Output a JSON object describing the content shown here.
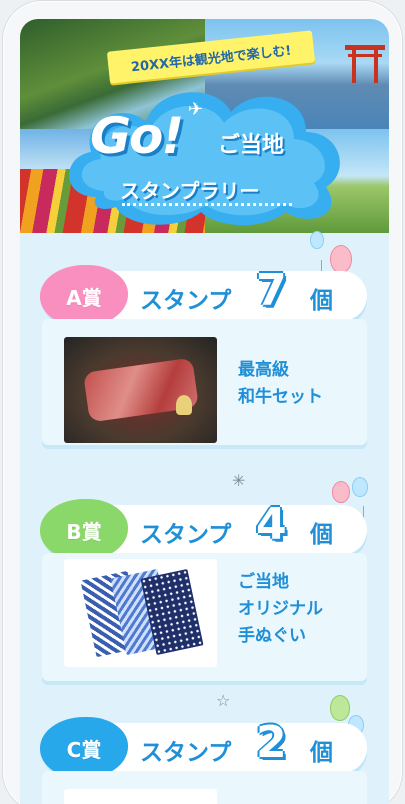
{
  "hero": {
    "banner": "20XX年は観光地で楽しむ!",
    "title_go": "Go!",
    "title_ja": "ご当地",
    "subtitle": "スタンプラリー"
  },
  "prizes": [
    {
      "rank": "A賞",
      "stamp_label": "スタンプ",
      "count": "7",
      "unit": "個",
      "name_lines": [
        "最高級",
        "和牛セット"
      ],
      "image": "wagyu-beef-photo"
    },
    {
      "rank": "B賞",
      "stamp_label": "スタンプ",
      "count": "4",
      "unit": "個",
      "name_lines": [
        "ご当地",
        "オリジナル",
        "手ぬぐい"
      ],
      "image": "tenugui-towels-photo"
    },
    {
      "rank": "C賞",
      "stamp_label": "スタンプ",
      "count": "2",
      "unit": "個",
      "name_lines": [],
      "image": ""
    }
  ],
  "colors": {
    "accent_blue": "#1f8fd8",
    "badge_a": "#f98fbf",
    "badge_b": "#8bd86a",
    "badge_c": "#27a8ea",
    "banner_yellow": "#fff36a",
    "background": "#dff2fb"
  }
}
